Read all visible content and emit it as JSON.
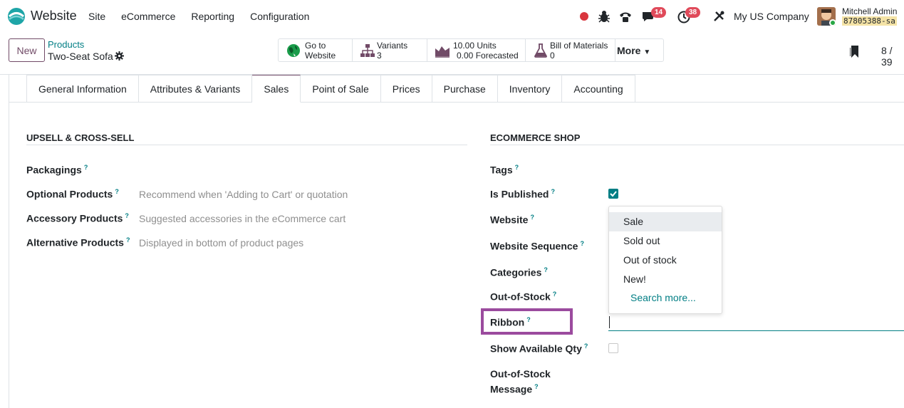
{
  "navbar": {
    "app_name": "Website",
    "menu": [
      "Site",
      "eCommerce",
      "Reporting",
      "Configuration"
    ],
    "messages_count": "14",
    "activities_count": "38",
    "company": "My US Company",
    "user_name": "Mitchell Admin",
    "db_name": "87805388-sa",
    "icons": [
      "record-dot",
      "bug-icon",
      "phone-icon",
      "chat-icon",
      "clock-icon",
      "tools-icon"
    ]
  },
  "control": {
    "new_label": "New",
    "breadcrumb_parent": "Products",
    "breadcrumb_current": "Two-Seat Sofa",
    "pager": "8 / 39"
  },
  "smart_buttons": {
    "website": {
      "line1": "Go to",
      "line2": "Website"
    },
    "variants": {
      "line1": "Variants",
      "line2": "3"
    },
    "units": {
      "line1": "10.00 Units",
      "line2": "0.00 Forecasted"
    },
    "bom": {
      "line1": "Bill of Materials",
      "line2": "0"
    },
    "more": "More"
  },
  "tabs": [
    "General Information",
    "Attributes & Variants",
    "Sales",
    "Point of Sale",
    "Prices",
    "Purchase",
    "Inventory",
    "Accounting"
  ],
  "active_tab": "Sales",
  "upsell": {
    "title": "UPSELL & CROSS-SELL",
    "fields": [
      {
        "label": "Packagings",
        "placeholder": ""
      },
      {
        "label": "Optional Products",
        "placeholder": "Recommend when 'Adding to Cart' or quotation"
      },
      {
        "label": "Accessory Products",
        "placeholder": "Suggested accessories in the eCommerce cart"
      },
      {
        "label": "Alternative Products",
        "placeholder": "Displayed in bottom of product pages"
      }
    ]
  },
  "ecommerce": {
    "title": "ECOMMERCE SHOP",
    "tags": "Tags",
    "is_published": "Is Published",
    "website": "Website",
    "website_sequence": "Website Sequence",
    "categories": "Categories",
    "out_of_stock": "Out-of-Stock",
    "ribbon": "Ribbon",
    "show_available_qty": "Show Available Qty",
    "oos_message_1": "Out-of-Stock",
    "oos_message_2": "Message",
    "is_published_checked": true,
    "show_available_qty_checked": false
  },
  "ribbon_dropdown": {
    "items": [
      "Sale",
      "Sold out",
      "Out of stock",
      "New!"
    ],
    "search_more": "Search more..."
  },
  "help_mark": "?",
  "colors": {
    "accent": "#714b67",
    "teal": "#017e84",
    "highlight": "#9b4b9e"
  }
}
